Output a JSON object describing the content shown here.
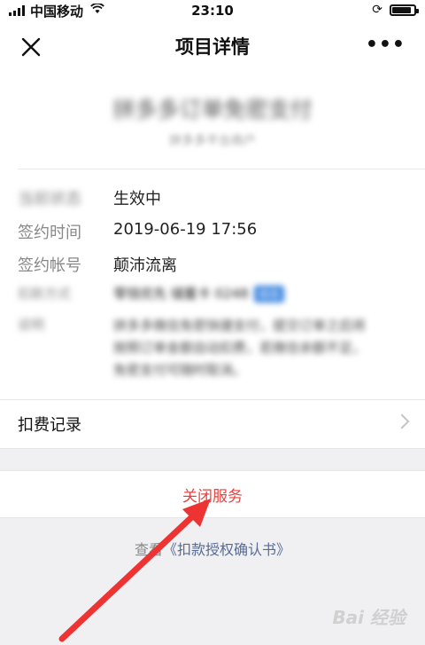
{
  "status_bar": {
    "carrier": "中国移动",
    "time": "23:10"
  },
  "nav": {
    "title": "项目详情",
    "more": "•••"
  },
  "merchant": {
    "name": "拼多多订单免密支付",
    "subtitle": "拼多多平台商户"
  },
  "details": [
    {
      "key": "当前状态",
      "value": "生效中",
      "blurred_key": true,
      "blurred_value": false
    },
    {
      "key": "签约时间",
      "value": "2019-06-19 17:56",
      "blurred_key": false,
      "blurred_value": false
    },
    {
      "key": "签约帐号",
      "value": "颠沛流离",
      "blurred_key": false,
      "blurred_value": false
    },
    {
      "key": "扣款方式",
      "value": "零钱优先 储蓄卡 0248",
      "badge": "修改",
      "blurred_key": true,
      "blurred_value": true
    },
    {
      "key": "说明",
      "value": "拼多多微信免密快捷支付，提交订单之后将按照订单金额自动扣费，若微信余额不足，免密支付可随时取消。",
      "blurred_key": true,
      "blurred_value": true
    }
  ],
  "record": {
    "label": "扣费记录"
  },
  "actions": {
    "close_service": "关闭服务"
  },
  "agreement": {
    "prefix": "查看",
    "link": "《扣款授权确认书》"
  },
  "watermark": {
    "text": "Bai 经验"
  },
  "colors": {
    "danger": "#e64340",
    "link": "#576b95",
    "annotation_arrow": "#ee3333"
  }
}
